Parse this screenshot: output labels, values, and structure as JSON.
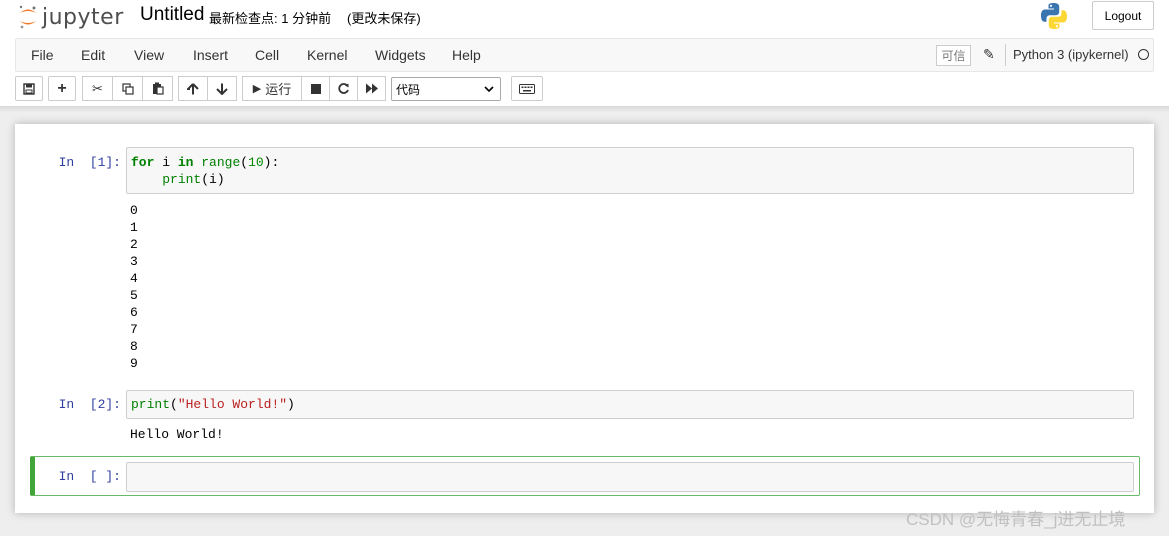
{
  "header": {
    "logo_text": "jupyter",
    "notebook_name": "Untitled",
    "checkpoint": "最新检查点: 1 分钟前",
    "autosave": "(更改未保存)",
    "logout_label": "Logout"
  },
  "menubar": {
    "items": [
      "File",
      "Edit",
      "View",
      "Insert",
      "Cell",
      "Kernel",
      "Widgets",
      "Help"
    ],
    "trusted_label": "可信",
    "kernel_name": "Python 3 (ipykernel)"
  },
  "toolbar": {
    "run_label": "运行",
    "cell_type_selected": "代码"
  },
  "cells": [
    {
      "prompt": "In  [1]:",
      "code": [
        "for i in range(10):",
        "    print(i)"
      ],
      "output": [
        "0",
        "1",
        "2",
        "3",
        "4",
        "5",
        "6",
        "7",
        "8",
        "9"
      ]
    },
    {
      "prompt": "In  [2]:",
      "code": [
        "print(\"Hello World!\")"
      ],
      "output": [
        "Hello World!"
      ]
    },
    {
      "prompt": "In  [ ]:",
      "code": [],
      "output": []
    }
  ],
  "watermark": "CSDN @无悔青春_j进无止境",
  "colors": {
    "prompt": "#303f9f",
    "keyword": "#008000",
    "string": "#ba2121",
    "selected_border": "#42a53a"
  }
}
